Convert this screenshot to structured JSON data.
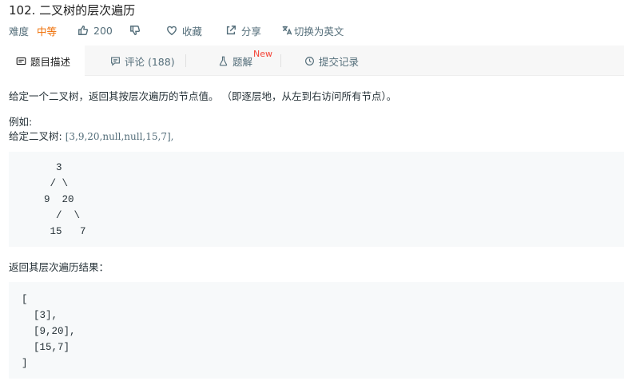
{
  "problem": {
    "title": "102. 二叉树的层次遍历"
  },
  "meta": {
    "difficulty_label": "难度",
    "difficulty_value": "中等",
    "likes": "200",
    "favorite_label": "收藏",
    "share_label": "分享",
    "lang_switch_label": "切换为英文",
    "colors": {
      "difficulty": "#ef6c00",
      "muted": "#546e7a",
      "new_badge": "#f44336"
    }
  },
  "tabs": [
    {
      "label": "题目描述",
      "icon": "description-icon",
      "active": true
    },
    {
      "label": "评论 (188)",
      "icon": "comment-icon",
      "active": false
    },
    {
      "label": "题解",
      "icon": "flask-icon",
      "active": false,
      "badge": "New"
    },
    {
      "label": "提交记录",
      "icon": "history-icon",
      "active": false
    }
  ],
  "content": {
    "description": "给定一个二叉树，返回其按层次遍历的节点值。 （即逐层地，从左到右访问所有节点）。",
    "example_label": "例如:",
    "given_prefix": "给定二叉树: ",
    "given_value": "[3,9,20,null,null,15,7]",
    "given_suffix": ",",
    "tree_diagram": "    3\n   / \\\n  9  20\n    /  \\\n   15   7",
    "result_label": "返回其层次遍历结果：",
    "result_code": "[\n  [3],\n  [9,20],\n  [15,7]\n]"
  }
}
